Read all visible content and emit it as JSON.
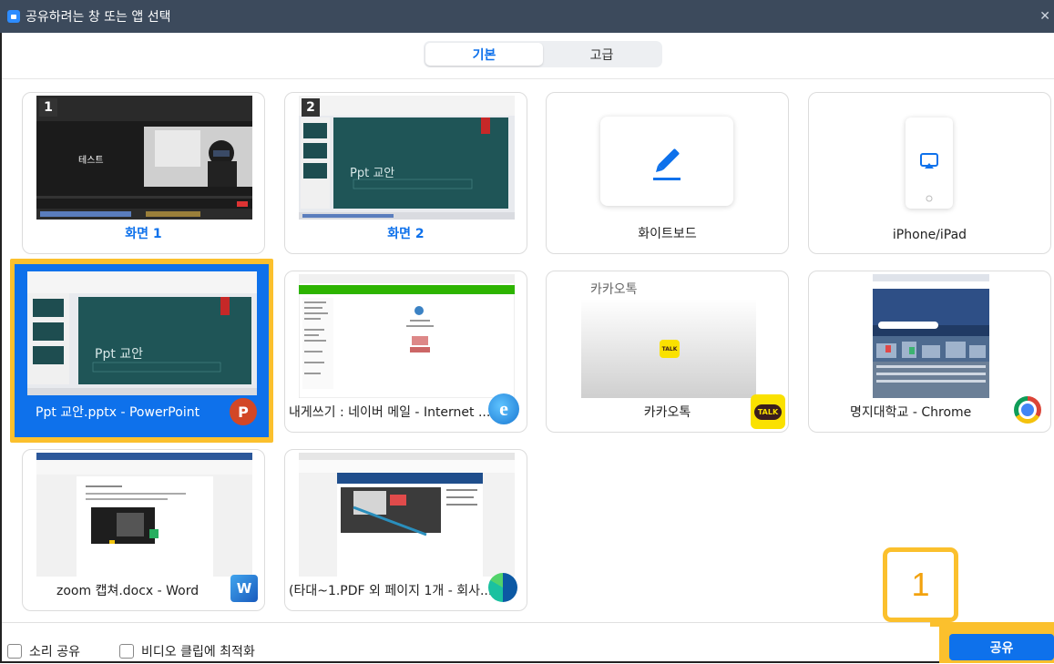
{
  "window": {
    "title": "공유하려는 창 또는 앱 선택"
  },
  "tabs": [
    {
      "label": "기본",
      "active": true
    },
    {
      "label": "고급",
      "active": false
    }
  ],
  "cards": {
    "screen1": {
      "label": "화면 1",
      "number": "1",
      "thumb_text": "테스트"
    },
    "screen2": {
      "label": "화면 2",
      "number": "2",
      "thumb_text": "Ppt 교안"
    },
    "whiteboard": {
      "label": "화이트보드",
      "icon": "pen-icon"
    },
    "iphone": {
      "label": "iPhone/iPad",
      "icon": "airplay-icon"
    },
    "powerpoint": {
      "label": "Ppt 교안.pptx - PowerPoint",
      "thumb_text": "Ppt 교안",
      "badge": "P",
      "selected": true
    },
    "mail": {
      "label": "내게쓰기 : 네이버 메일 - Internet ...",
      "badge": "e"
    },
    "kakao": {
      "label": "카카오톡",
      "thumb_text": "카카오톡",
      "badge": "TALK"
    },
    "chrome": {
      "label": "명지대학교 - Chrome"
    },
    "word": {
      "label": "zoom 캡쳐.docx - Word",
      "badge": "W"
    },
    "pdf": {
      "label": "(타대~1.PDF 외 페이지 1개 - 회사..."
    }
  },
  "options": {
    "share_sound": "소리 공유",
    "optimize_video": "비디오 클립에 최적화"
  },
  "share_button": "공유",
  "callout": "1",
  "colors": {
    "accent": "#0e71eb",
    "highlight": "#fbc02d",
    "titlebar": "#3c4a5c"
  }
}
